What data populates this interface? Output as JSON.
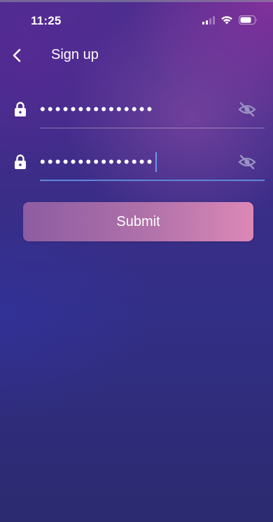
{
  "status_bar": {
    "time": "11:25"
  },
  "header": {
    "title": "Sign up",
    "back_icon": "chevron-left-icon"
  },
  "form": {
    "fields": [
      {
        "id": "password",
        "value": "•••••••••••••••",
        "leading_icon": "lock-icon",
        "trailing_icon": "eye-off-icon",
        "focused": false
      },
      {
        "id": "confirm-password",
        "value": "•••••••••••••••",
        "leading_icon": "lock-icon",
        "trailing_icon": "eye-off-icon",
        "focused": true
      }
    ],
    "submit_label": "Submit"
  },
  "colors": {
    "accent_underline": "#5f86d9",
    "button_gradient_start": "#8d5ca2",
    "button_gradient_end": "#dc88b6",
    "background_top": "#4d2e8f",
    "background_bottom": "#2c2a6f"
  }
}
